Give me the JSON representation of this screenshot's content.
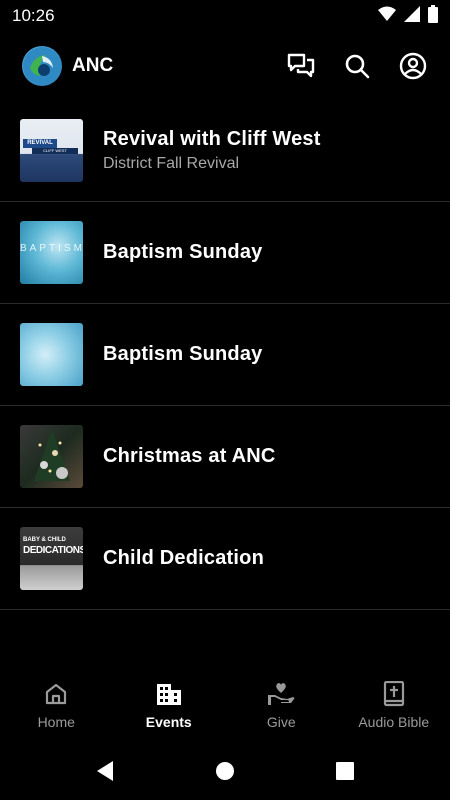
{
  "status_bar": {
    "time": "10:26",
    "icons": [
      "wifi-icon",
      "signal-icon",
      "battery-icon"
    ]
  },
  "app_bar": {
    "title": "ANC",
    "actions": [
      "chat-icon",
      "search-icon",
      "account-icon"
    ]
  },
  "events": [
    {
      "title": "Revival with Cliff West",
      "subtitle": "District Fall Revival",
      "thumb_text": "REVIVAL",
      "thumb_text2": "CLIFF WEST"
    },
    {
      "title": "Baptism Sunday",
      "subtitle": "",
      "thumb_text": "BAPTISM"
    },
    {
      "title": "Baptism Sunday",
      "subtitle": ""
    },
    {
      "title": "Christmas at ANC",
      "subtitle": ""
    },
    {
      "title": "Child Dedication",
      "subtitle": "",
      "thumb_text": "BABY & CHILD",
      "thumb_text2": "DEDICATIONS"
    }
  ],
  "bottom_nav": {
    "active": "Events",
    "items": [
      {
        "label": "Home",
        "icon": "home-icon"
      },
      {
        "label": "Events",
        "icon": "calendar-building-icon"
      },
      {
        "label": "Give",
        "icon": "give-hand-heart-icon"
      },
      {
        "label": "Audio Bible",
        "icon": "bible-icon"
      }
    ]
  },
  "system_nav": [
    "back-icon",
    "home-circle-icon",
    "recents-icon"
  ],
  "colors": {
    "background": "#000000",
    "text_primary": "#ffffff",
    "text_secondary": "#a8a8a8",
    "nav_inactive": "#9a9a9a",
    "divider": "#2b2b2b"
  }
}
